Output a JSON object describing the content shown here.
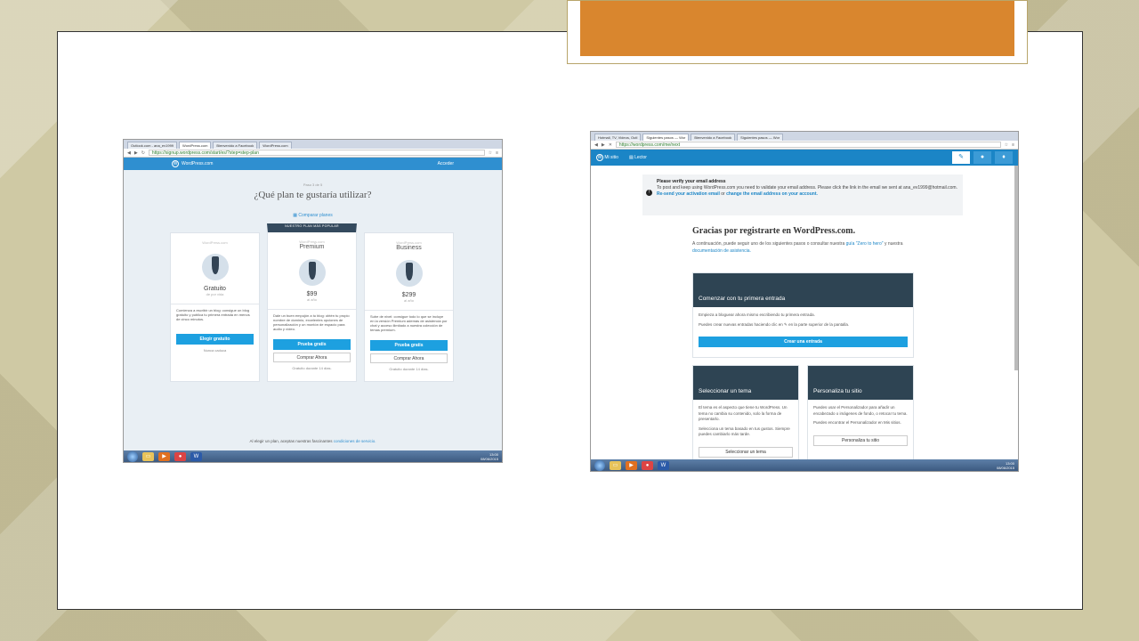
{
  "shot1": {
    "tabs": [
      "Outlook.com - ana_ev1999",
      "WordPress.com",
      "Bienvenido a Facebook",
      "WordPress.com"
    ],
    "url": "https://signup.wordpress.com/start/es/?step=step-plan",
    "tooltip": "WordPress.com",
    "header": {
      "brand": "WordPress.com",
      "login": "Acceder"
    },
    "step": "Paso 3 de 5",
    "question": "¿Qué plan te gustaría utilizar?",
    "compare": "Comparar planes",
    "popular_label": "NUESTRO PLAN MÁS POPULAR",
    "plans": [
      {
        "brand": "WordPress.com",
        "name": "",
        "price": "Gratuito",
        "per": "de por vida",
        "desc": "Comienza a escribir un blog: consigue un blog gratuito y publica tu primera entrada en menos de cinco minutos.",
        "button": "Elegir gratuito",
        "secondary": "",
        "note": "Nunca caduca"
      },
      {
        "brand": "WordPress.com",
        "name": "Premium",
        "price": "$99",
        "per": "al año",
        "desc": "Dale un buen empujón a tu blog: obtén tu propio nombre de dominio, excelentes opciones de personalización y un montón de espacio para audio y vídeo.",
        "button": "Prueba gratis",
        "secondary": "Comprar Ahora",
        "note": "Gratuito durante 14 días."
      },
      {
        "brand": "WordPress.com",
        "name": "Business",
        "price": "$299",
        "per": "al año",
        "desc": "Sube de nivel: consigue todo lo que se incluye en la versión Premium además de asistencia por chat y acceso ilimitado a nuestra colección de temas premium.",
        "button": "Prueba gratis",
        "secondary": "Comprar Ahora",
        "note": "Gratuito durante 14 días."
      }
    ],
    "terms_prefix": "Al elegir un plan, aceptas nuestras fascinantes",
    "terms_link": "condiciones de servicio.",
    "back": "Volver al paso anterior",
    "clock_time": "13:00",
    "clock_date": "08/06/2015"
  },
  "shot2": {
    "tabs": [
      "Hotmail, TV, Videos, Outl",
      "Siguientes pasos — Wor",
      "Bienvenido a Facebook",
      "Siguientes pasos — Wor"
    ],
    "url": "https://wordpress.com/me/next",
    "nav": {
      "my_site": "Mi sitio",
      "reader": "Lector"
    },
    "notice": {
      "title": "Please verify your email address",
      "text": "To post and keep using WordPress.com you need to validate your email address. Please click the link in the email we sent at ana_ev1999@hotmail.com.",
      "resend": "Re-send your activation email",
      "or": "or",
      "change": "change the email address on your account."
    },
    "thanks": "Gracias por registrarte en WordPress.com.",
    "sub_text": "A continuación, puede seguir uno de los siguientes pasos o consultar nuestra",
    "sub_link1": "guía \"Zero to hero\"",
    "sub_and": "y nuestra",
    "sub_link2": "documentación de asistencia.",
    "card_main": {
      "title": "Comenzar con tu primera entrada",
      "p1": "Empieza a bloguear ahora mismo escribiendo tu primera entrada.",
      "p2": "Puedes crear nuevas entradas haciendo clic en ✎ en la parte superior de la pantalla.",
      "button": "Crear una entrada"
    },
    "card_theme": {
      "title": "Seleccionar un tema",
      "p1": "El tema es el aspecto que tiene tu WordPress. Un tema no cambia su contenido, solo la forma de presentarlo.",
      "p2": "Selecciona un tema basado en tus gustos. Siempre puedes cambiarlo más tarde.",
      "button": "Seleccionar un tema"
    },
    "card_custom": {
      "title": "Personaliza tu sitio",
      "p1": "Puedes usar el Personalizador para añadir un encabezado o imágenes de fondo, o retocar tu tema.",
      "p2": "Puedes encontrar el Personalizador en Mis sitios.",
      "button": "Personaliza tu sitio"
    },
    "clock_time": "13:00",
    "clock_date": "08/06/2015"
  }
}
